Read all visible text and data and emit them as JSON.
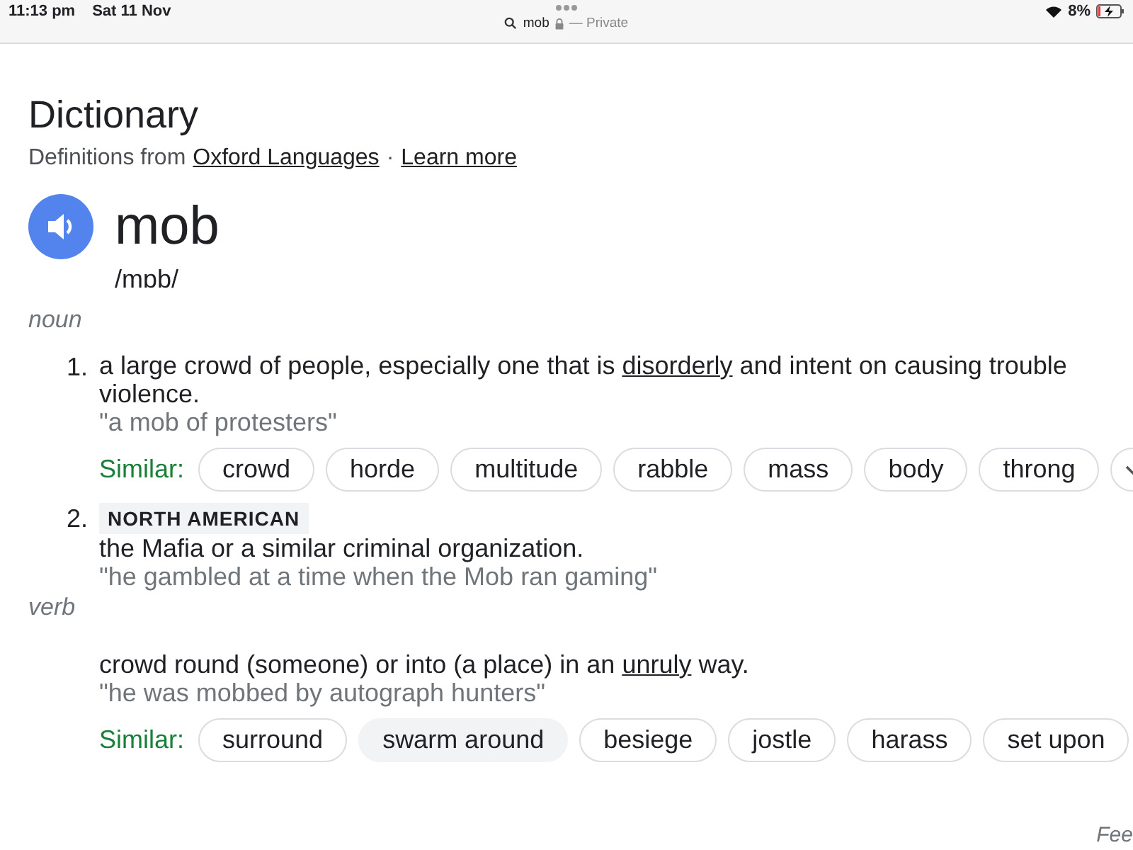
{
  "status_bar": {
    "time": "11:13 pm",
    "date": "Sat 11 Nov",
    "battery": "8%"
  },
  "address_bar": {
    "query": "mob",
    "mode": "— Private"
  },
  "heading": "Dictionary",
  "source": {
    "prefix": "Definitions from",
    "link": "Oxford Languages",
    "separator": "·",
    "learn_more": "Learn more"
  },
  "entry": {
    "word": "mob",
    "pronunciation": "/mɒb/"
  },
  "senses": [
    {
      "part_of_speech": "noun",
      "definitions": [
        {
          "number": "1.",
          "lines": [
            {
              "before": "a large crowd of people, especially one that is ",
              "link": "disorderly",
              "after": " and intent on causing trouble"
            },
            {
              "before": "violence."
            }
          ],
          "example": "\"a mob of protesters\"",
          "similar_label": "Similar:",
          "similar": [
            {
              "text": "crowd",
              "highlighted": false
            },
            {
              "text": "horde",
              "highlighted": false
            },
            {
              "text": "multitude",
              "highlighted": false
            },
            {
              "text": "rabble",
              "highlighted": false
            },
            {
              "text": "mass",
              "highlighted": false
            },
            {
              "text": "body",
              "highlighted": false
            },
            {
              "text": "throng",
              "highlighted": false
            }
          ]
        },
        {
          "number": "2.",
          "label": "NORTH AMERICAN",
          "lines": [
            {
              "before": "the Mafia or a similar criminal organization."
            }
          ],
          "example": "\"he gambled at a time when the Mob ran gaming\""
        }
      ]
    },
    {
      "part_of_speech": "verb",
      "definitions": [
        {
          "lines": [
            {
              "before": "crowd round (someone) or into (a place) in an ",
              "link": "unruly",
              "after": " way."
            }
          ],
          "example": "\"he was mobbed by autograph hunters\"",
          "similar_label": "Similar:",
          "similar": [
            {
              "text": "surround",
              "highlighted": false
            },
            {
              "text": "swarm around",
              "highlighted": true
            },
            {
              "text": "besiege",
              "highlighted": false
            },
            {
              "text": "jostle",
              "highlighted": false
            },
            {
              "text": "harass",
              "highlighted": false
            },
            {
              "text": "set upon",
              "highlighted": false
            }
          ]
        }
      ]
    }
  ],
  "feedback": "Fee"
}
